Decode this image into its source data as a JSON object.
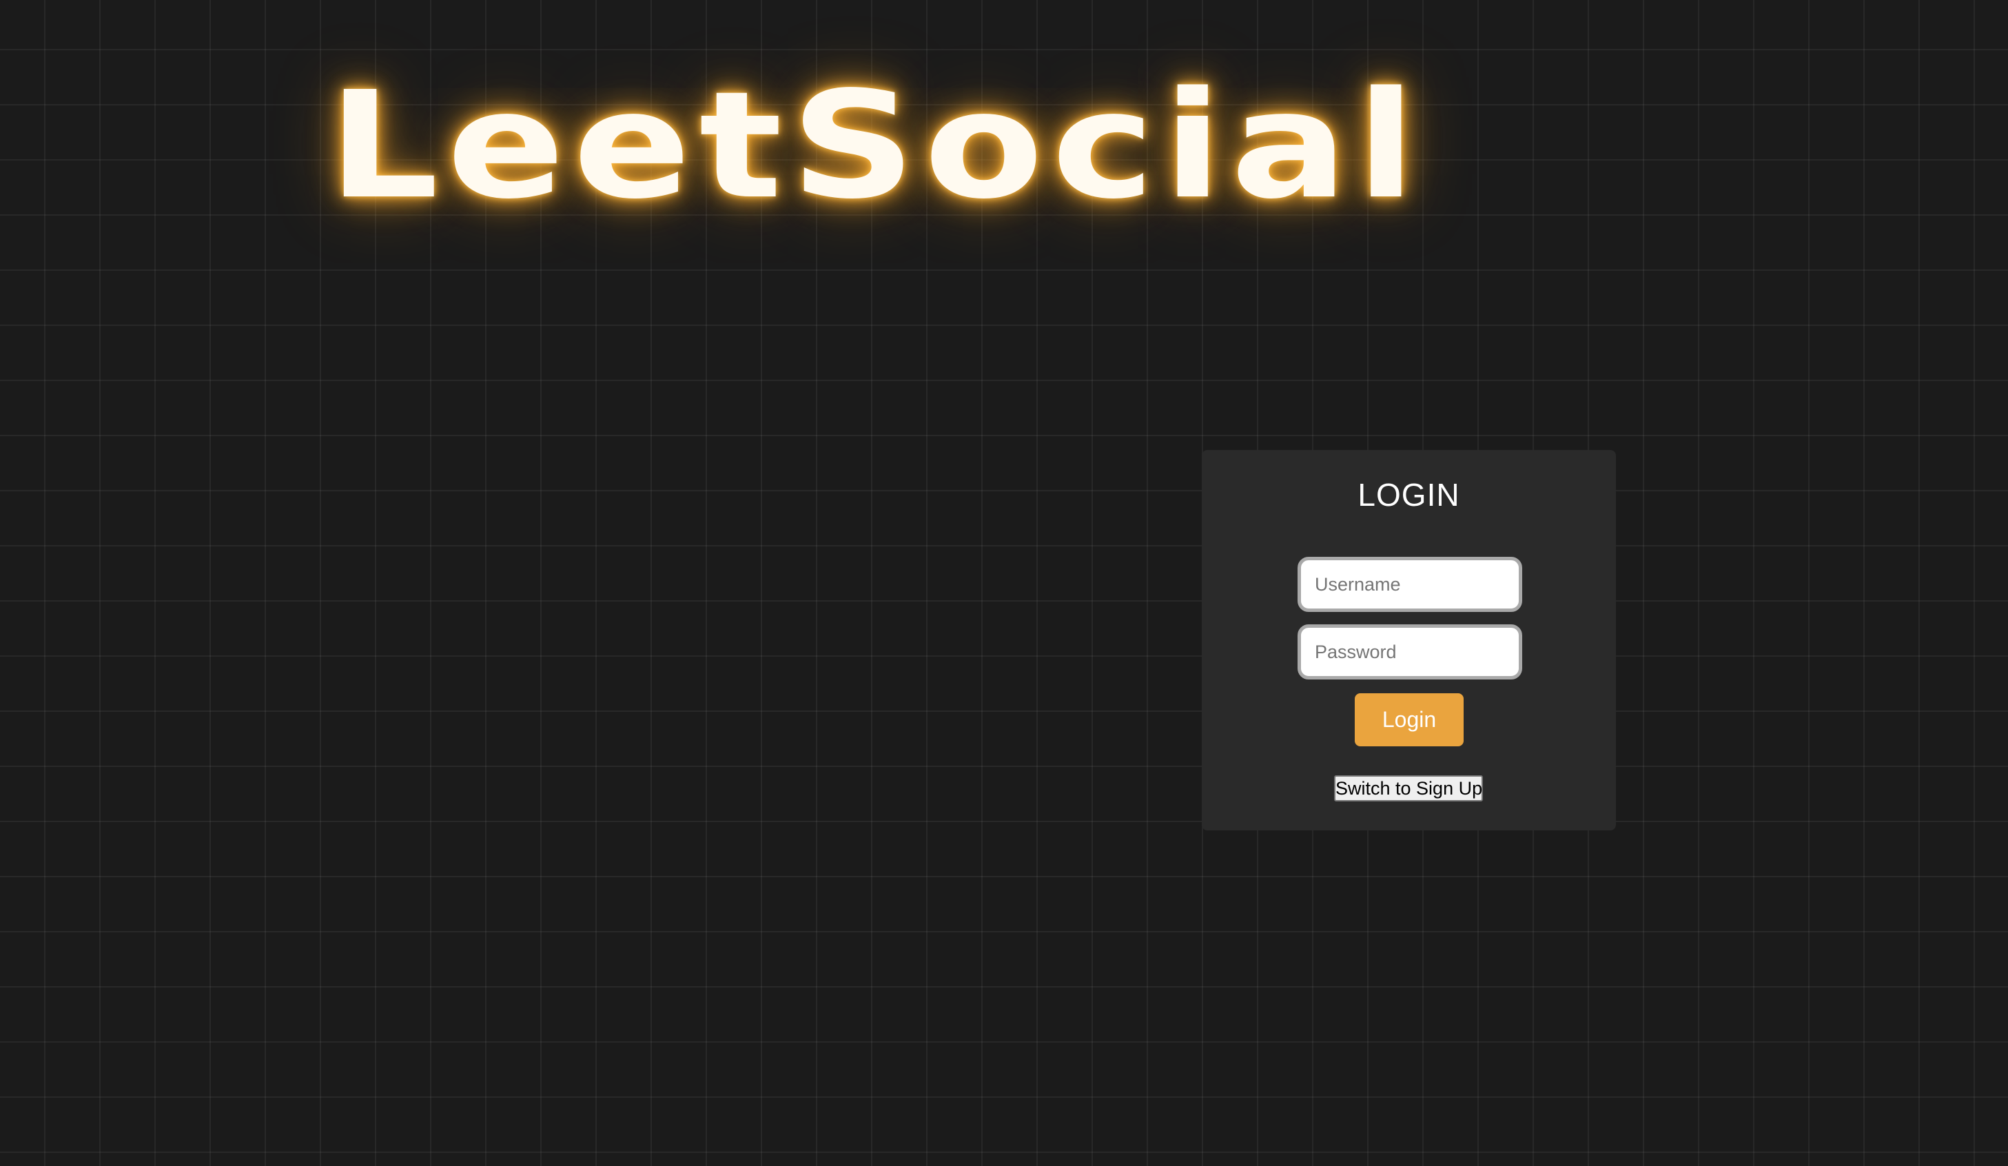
{
  "brand": {
    "title": "LeetSocial",
    "glow_color": "#f0a830"
  },
  "login": {
    "heading": "LOGIN",
    "username_placeholder": "Username",
    "password_placeholder": "Password",
    "submit_label": "Login",
    "switch_label": "Switch to Sign Up"
  },
  "colors": {
    "background": "#1b1b1b",
    "panel": "#2a2a2a",
    "accent": "#eaa43e",
    "text": "#ffffff"
  }
}
